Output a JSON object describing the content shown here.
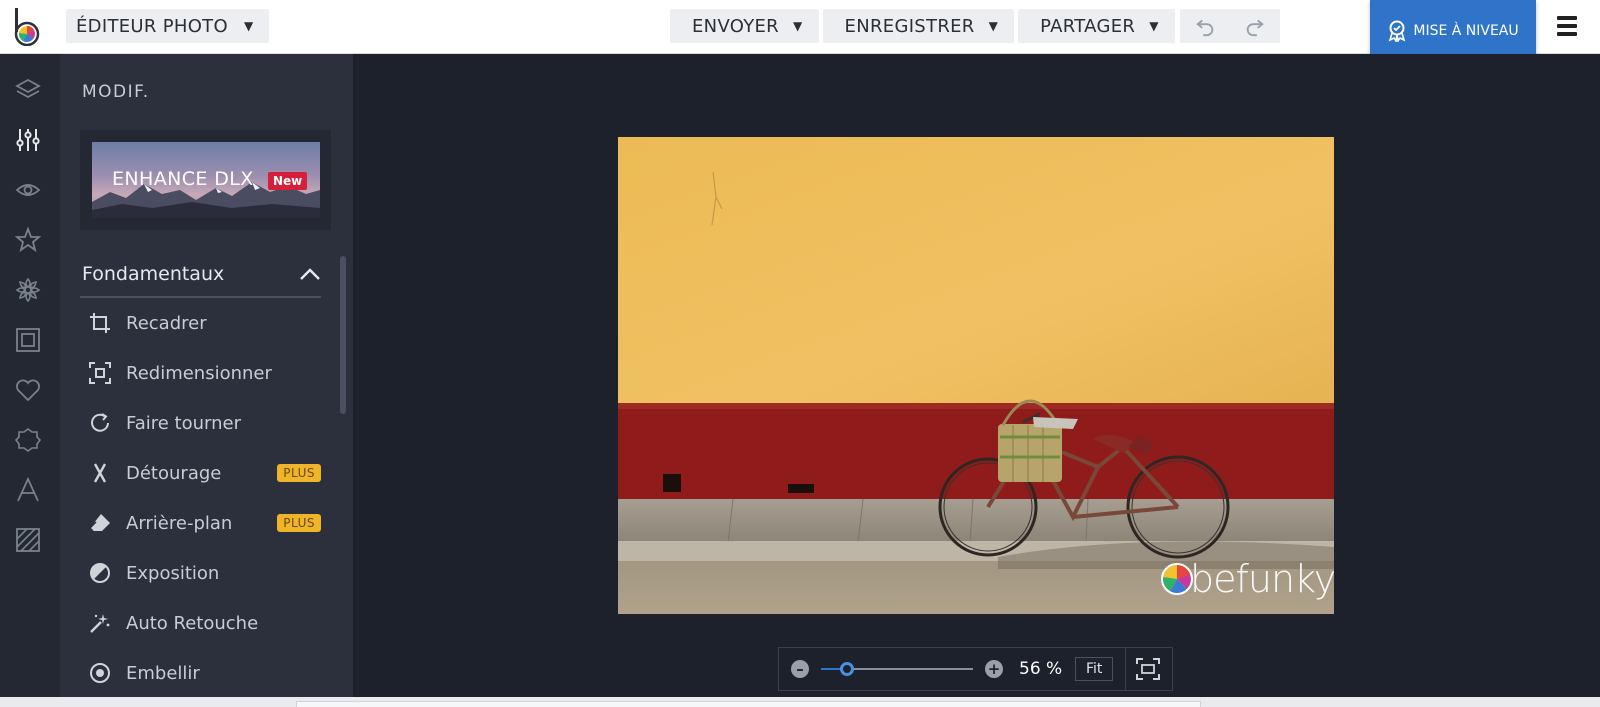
{
  "app": {
    "mode_label": "ÉDITEUR PHOTO",
    "logo_icon": "befunky-logo"
  },
  "toolbar": {
    "send_label": "ENVOYER",
    "save_label": "ENREGISTRER",
    "share_label": "PARTAGER",
    "undo_icon": "undo-icon",
    "redo_icon": "redo-icon",
    "upgrade_label": "MISE À NIVEAU",
    "upgrade_color": "#2f74c9",
    "menu_icon": "hamburger-icon"
  },
  "rail": {
    "icons": [
      "layers-icon",
      "sliders-icon",
      "eye-icon",
      "star-icon",
      "flower-icon",
      "frame-icon",
      "heart-icon",
      "badge-icon",
      "text-icon",
      "texture-icon"
    ],
    "active": "sliders-icon"
  },
  "panel": {
    "title": "MODIF.",
    "promo": {
      "label": "ENHANCE DLX",
      "badge": "New"
    },
    "section": {
      "label": "Fondamentaux",
      "expanded": true
    },
    "tools": [
      {
        "label": "Recadrer",
        "icon": "crop-icon",
        "plus": ""
      },
      {
        "label": "Redimensionner",
        "icon": "resize-icon",
        "plus": ""
      },
      {
        "label": "Faire tourner",
        "icon": "rotate-icon",
        "plus": ""
      },
      {
        "label": "Détourage",
        "icon": "cutout-icon",
        "plus": "PLUS"
      },
      {
        "label": "Arrière-plan",
        "icon": "eraser-icon",
        "plus": "PLUS"
      },
      {
        "label": "Exposition",
        "icon": "exposure-icon",
        "plus": ""
      },
      {
        "label": "Auto Retouche",
        "icon": "magic-wand-icon",
        "plus": ""
      },
      {
        "label": "Embellir",
        "icon": "beautify-icon",
        "plus": ""
      }
    ],
    "plus_color": "#f0b429"
  },
  "canvas": {
    "watermark": "befunky",
    "zoom_percent": "56 %",
    "zoom_value": 0.17,
    "fit_label": "Fit",
    "fullscreen_icon": "fullscreen-icon"
  }
}
